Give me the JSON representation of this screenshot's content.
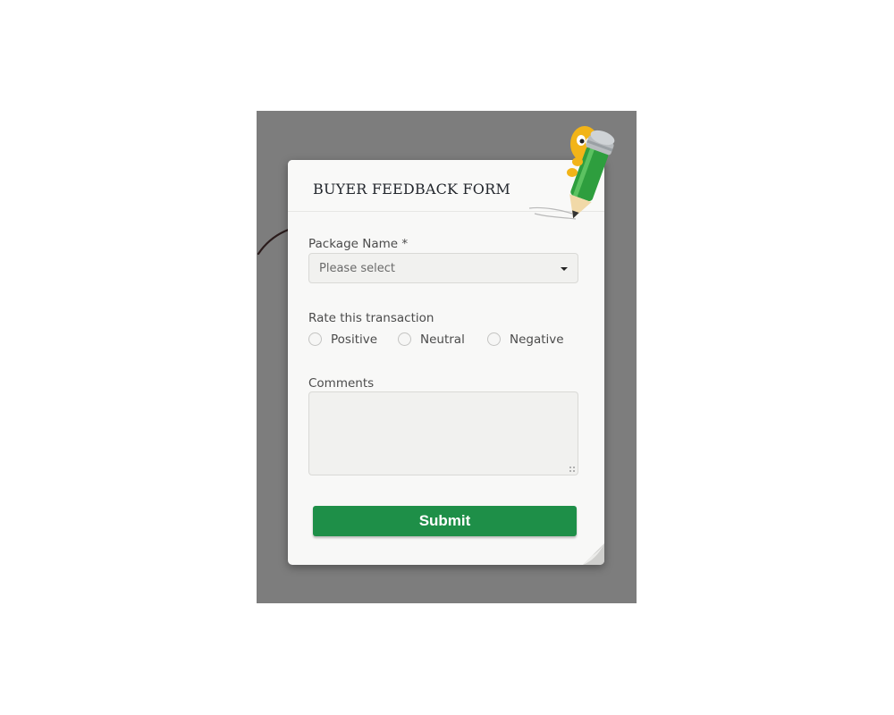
{
  "form": {
    "title": "BUYER FEEDBACK FORM",
    "package_label": "Package Name *",
    "package_select": {
      "value": "Please select"
    },
    "rate_label": "Rate this transaction",
    "rating_options": [
      "Positive",
      "Neutral",
      "Negative"
    ],
    "comments_label": "Comments",
    "comments_value": "",
    "submit_label": "Submit"
  },
  "colors": {
    "backdrop": "#7d7d7d",
    "card": "#f8f8f7",
    "submit": "#1e8f48",
    "title_text": "#23272d",
    "mascot_green": "#2e9e3e",
    "mascot_yellow": "#f2b418"
  },
  "icons": [
    "hand-drawn-arrow",
    "pencil-mascot",
    "dropdown-caret",
    "page-curl",
    "resize-grip"
  ]
}
